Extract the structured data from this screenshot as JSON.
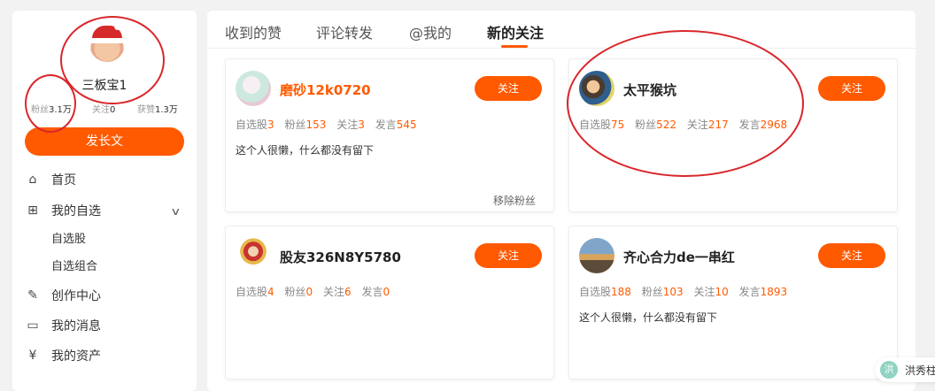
{
  "profile": {
    "username": "三板宝1",
    "fans_label": "粉丝",
    "fans_value": "3.1万",
    "following_label": "关注",
    "following_value": "0",
    "likes_label": "获赞",
    "likes_value": "1.3万",
    "post_button": "发长文"
  },
  "nav": [
    {
      "label": "首页",
      "icon": "home-icon"
    },
    {
      "label": "我的自选",
      "icon": "plus-square-icon"
    },
    {
      "label": "自选股",
      "icon": ""
    },
    {
      "label": "自选组合",
      "icon": ""
    },
    {
      "label": "创作中心",
      "icon": "edit-icon"
    },
    {
      "label": "我的消息",
      "icon": "message-icon"
    },
    {
      "label": "我的资产",
      "icon": "yen-icon"
    }
  ],
  "tabs": [
    "收到的赞",
    "评论转发",
    "@我的",
    "新的关注"
  ],
  "active_tab": "新的关注",
  "labels": {
    "stocks": "自选股",
    "fans": "粉丝",
    "following": "关注",
    "posts": "发言",
    "follow_button": "关注",
    "remove_fan": "移除粉丝"
  },
  "cards": [
    {
      "name": "磨砂12k0720",
      "stocks": "3",
      "fans": "153",
      "following": "3",
      "posts": "545",
      "bio": "这个人很懒，什么都没有留下"
    },
    {
      "name": "太平猴坑",
      "stocks": "75",
      "fans": "522",
      "following": "217",
      "posts": "2968",
      "bio": ""
    },
    {
      "name": "股友326N8Y5780",
      "stocks": "4",
      "fans": "0",
      "following": "6",
      "posts": "0",
      "bio": ""
    },
    {
      "name": "齐心合力de一串红",
      "stocks": "188",
      "fans": "103",
      "following": "10",
      "posts": "1893",
      "bio": "这个人很懒，什么都没有留下"
    }
  ],
  "floating": {
    "glyph": "洪",
    "text": "洪秀柱"
  },
  "colors": {
    "accent": "#ff5a00",
    "annotation": "#d9262a"
  }
}
